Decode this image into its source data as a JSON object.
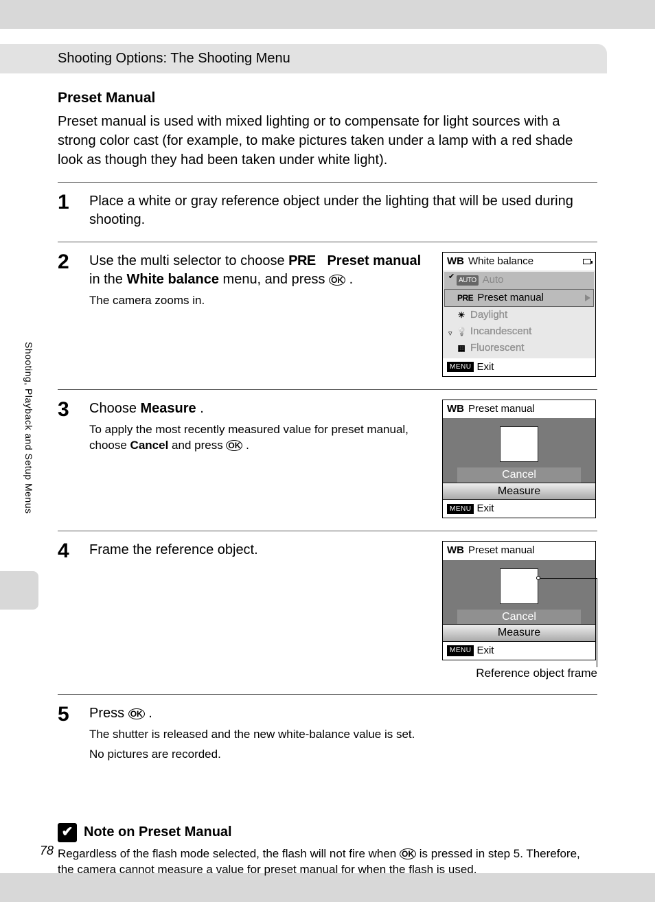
{
  "header": "Shooting Options: The Shooting Menu",
  "side_label": "Shooting, Playback and Setup Menus",
  "page_number": "78",
  "section_title": "Preset Manual",
  "intro": "Preset manual is used with mixed lighting or to compensate for light sources with a strong color cast (for example, to make pictures taken under a lamp with a red shade look as though they had been taken under white light).",
  "steps": {
    "s1": {
      "num": "1",
      "text": "Place a white or gray reference object under the lighting that will be used during shooting."
    },
    "s2": {
      "num": "2",
      "text_a": "Use the multi selector to choose ",
      "pre": "PRE",
      "text_b": "Preset manual",
      "text_c": " in the ",
      "text_d": "White balance",
      "text_e": " menu, and press ",
      "ok": "OK",
      "text_f": ".",
      "sub": "The camera zooms in."
    },
    "s3": {
      "num": "3",
      "text_a": "Choose ",
      "text_b": "Measure",
      "text_c": ".",
      "sub_a": "To apply the most recently measured value for preset manual, choose ",
      "sub_b": "Cancel",
      "sub_c": " and press ",
      "ok": "OK",
      "sub_d": "."
    },
    "s4": {
      "num": "4",
      "text": "Frame the reference object."
    },
    "s5": {
      "num": "5",
      "text_a": "Press ",
      "ok": "OK",
      "text_b": ".",
      "sub1": "The shutter is released and the new white-balance value is set.",
      "sub2": "No pictures are recorded."
    }
  },
  "lcd1": {
    "title": "White balance",
    "auto": "Auto",
    "preset": "Preset manual",
    "daylight": "Daylight",
    "incandescent": "Incandescent",
    "fluorescent": "Fluorescent",
    "exit": "Exit",
    "menu": "MENU",
    "wb": "WB",
    "pre": "PRE",
    "auto_tag": "AUTO"
  },
  "lcd2": {
    "title": "Preset manual",
    "cancel": "Cancel",
    "measure": "Measure",
    "exit": "Exit",
    "menu": "MENU",
    "wb": "WB"
  },
  "caption": "Reference object frame",
  "note": {
    "title": "Note on Preset Manual",
    "body_a": "Regardless of the flash mode selected, the flash will not fire when ",
    "ok": "OK",
    "body_b": " is pressed in step 5. Therefore, the camera cannot measure a value for preset manual for when the flash is used."
  }
}
